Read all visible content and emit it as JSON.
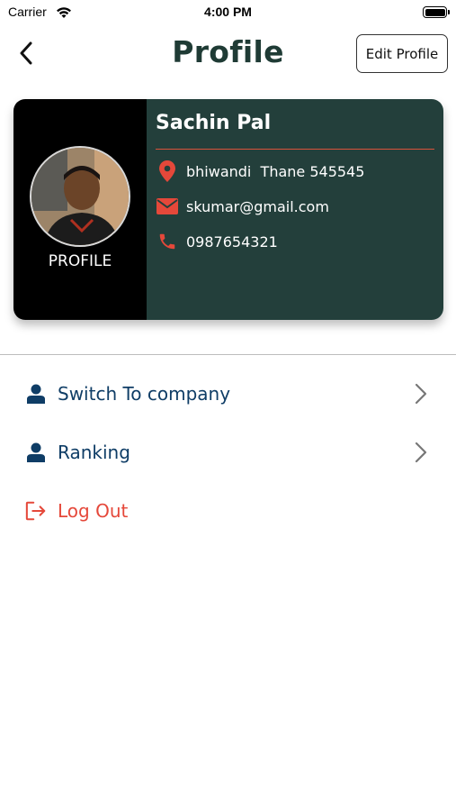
{
  "status_bar": {
    "carrier": "Carrier",
    "time": "4:00 PM"
  },
  "header": {
    "title": "Profile",
    "edit_button": "Edit Profile"
  },
  "card": {
    "name": "Sachin Pal",
    "avatar_label": "PROFILE",
    "address": "bhiwandi  Thane 545545",
    "email": "skumar@gmail.com",
    "phone": "0987654321"
  },
  "menu": [
    {
      "label": "Switch To company",
      "icon": "person-icon"
    },
    {
      "label": "Ranking",
      "icon": "person-icon"
    },
    {
      "label": "Log Out",
      "icon": "logout-icon"
    }
  ],
  "colors": {
    "title": "#1f3b35",
    "card_dark": "#233f3b",
    "accent_red": "#e5483a",
    "menu_text": "#0f3d66",
    "logout": "#e5483a"
  }
}
